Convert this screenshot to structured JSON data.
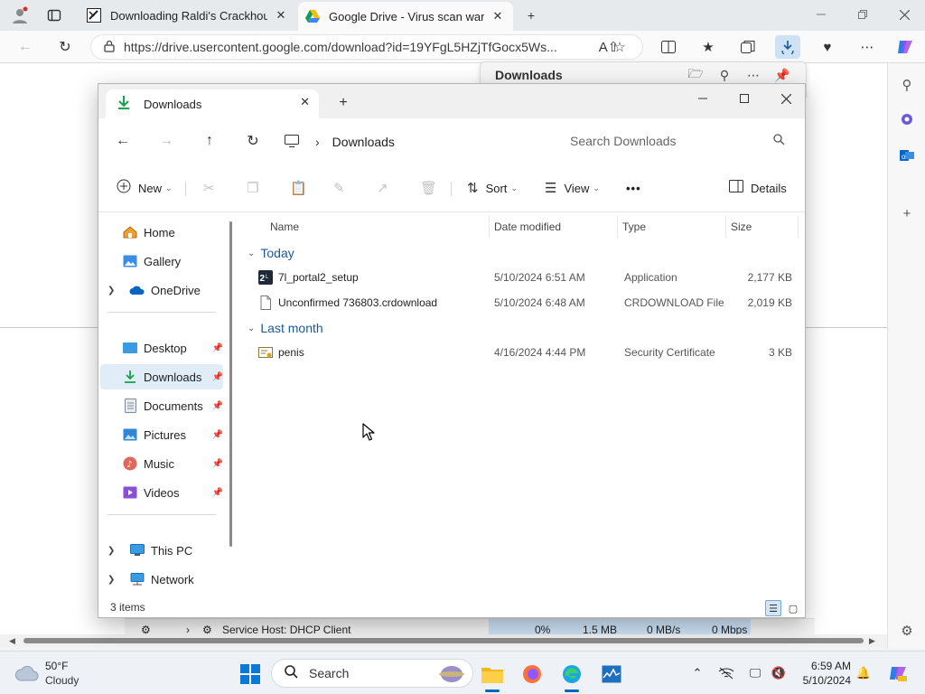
{
  "browser": {
    "tabs": [
      {
        "title": "Downloading Raldi's Crackhouse",
        "active": false
      },
      {
        "title": "Google Drive - Virus scan warning",
        "active": true
      }
    ],
    "new_tab_glyph": "+",
    "close_glyph": "✕",
    "url": "https://drive.usercontent.google.com/download?id=19YFgL5HZjTfGocx5Ws...",
    "downloads_flyout_title": "Downloads"
  },
  "explorer": {
    "tab_title": "Downloads",
    "breadcrumb": "Downloads",
    "search_placeholder": "Search Downloads",
    "commands": {
      "new": "New",
      "sort": "Sort",
      "view": "View",
      "more": "•••",
      "details": "Details"
    },
    "sidebar": [
      {
        "label": "Home",
        "icon": "home-icon",
        "expandable": false,
        "pinned": false,
        "selected": false
      },
      {
        "label": "Gallery",
        "icon": "gallery-icon",
        "expandable": false,
        "pinned": false,
        "selected": false
      },
      {
        "label": "OneDrive",
        "icon": "onedrive-icon",
        "expandable": true,
        "pinned": false,
        "selected": false
      },
      {
        "label": "Desktop",
        "icon": "desktop-icon",
        "expandable": false,
        "pinned": true,
        "selected": false
      },
      {
        "label": "Downloads",
        "icon": "downloads-icon",
        "expandable": false,
        "pinned": true,
        "selected": true
      },
      {
        "label": "Documents",
        "icon": "documents-icon",
        "expandable": false,
        "pinned": true,
        "selected": false
      },
      {
        "label": "Pictures",
        "icon": "pictures-icon",
        "expandable": false,
        "pinned": true,
        "selected": false
      },
      {
        "label": "Music",
        "icon": "music-icon",
        "expandable": false,
        "pinned": true,
        "selected": false
      },
      {
        "label": "Videos",
        "icon": "videos-icon",
        "expandable": false,
        "pinned": true,
        "selected": false
      },
      {
        "label": "This PC",
        "icon": "this-pc-icon",
        "expandable": true,
        "pinned": false,
        "selected": false
      },
      {
        "label": "Network",
        "icon": "network-icon",
        "expandable": true,
        "pinned": false,
        "selected": false
      }
    ],
    "columns": [
      "Name",
      "Date modified",
      "Type",
      "Size"
    ],
    "groups": [
      {
        "name": "Today",
        "files": [
          {
            "name": "7l_portal2_setup",
            "date": "5/10/2024 6:51 AM",
            "type": "Application",
            "size": "2,177 KB",
            "icon": "application-icon"
          },
          {
            "name": "Unconfirmed 736803.crdownload",
            "date": "5/10/2024 6:48 AM",
            "type": "CRDOWNLOAD File",
            "size": "2,019 KB",
            "icon": "file-icon"
          }
        ]
      },
      {
        "name": "Last month",
        "files": [
          {
            "name": "penis",
            "date": "4/16/2024 4:44 PM",
            "type": "Security Certificate",
            "size": "3 KB",
            "icon": "certificate-icon"
          }
        ]
      }
    ],
    "status": "3 items"
  },
  "task_manager_row": {
    "name": "Service Host: DHCP Client",
    "cpu": "0%",
    "memory": "1.5 MB",
    "disk": "0 MB/s",
    "network": "0 Mbps"
  },
  "taskbar": {
    "weather_temp": "50°F",
    "weather_cond": "Cloudy",
    "search_placeholder": "Search",
    "time": "6:59 AM",
    "date": "5/10/2024"
  },
  "colors": {
    "accent": "#0067c0",
    "selection": "#e0ecf8",
    "group_heading": "#1a5a96",
    "download_green": "#16a34a"
  }
}
